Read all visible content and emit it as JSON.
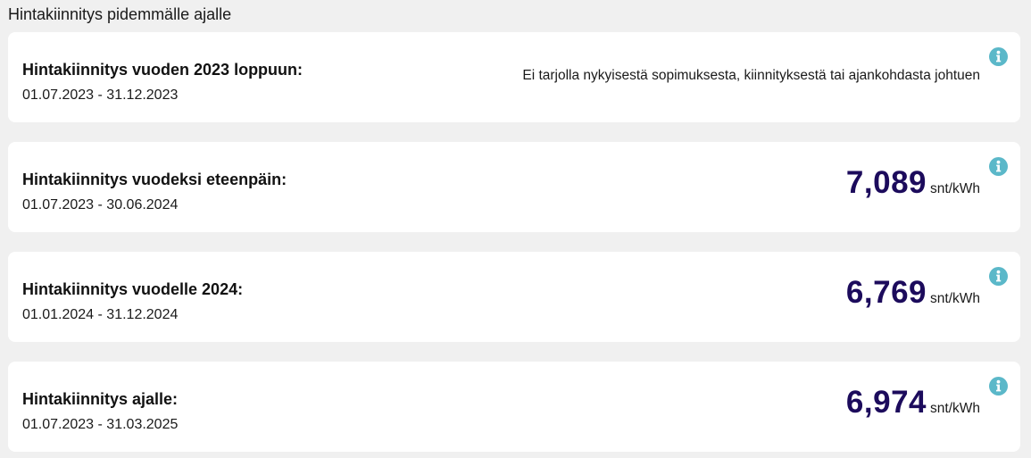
{
  "section": {
    "title": "Hintakiinnitys pidemmälle ajalle"
  },
  "cards": [
    {
      "title": "Hintakiinnitys vuoden 2023 loppuun:",
      "dates": "01.07.2023 - 31.12.2023",
      "note": "Ei tarjolla nykyisestä sopimuksesta, kiinnityksestä tai ajankohdasta johtuen",
      "icon": "info-icon"
    },
    {
      "title": "Hintakiinnitys vuodeksi eteenpäin:",
      "dates": "01.07.2023 - 30.06.2024",
      "price": "7,089",
      "unit": "snt/kWh",
      "icon": "info-icon"
    },
    {
      "title": "Hintakiinnitys vuodelle 2024:",
      "dates": "01.01.2024 - 31.12.2024",
      "price": "6,769",
      "unit": "snt/kWh",
      "icon": "info-icon"
    },
    {
      "title": "Hintakiinnitys ajalle:",
      "dates": "01.07.2023 - 31.03.2025",
      "price": "6,974",
      "unit": "snt/kWh",
      "icon": "info-icon"
    }
  ],
  "colors": {
    "background": "#f0f0f0",
    "card": "#ffffff",
    "price": "#1c0b5c",
    "info_icon": "#5bb8c9"
  }
}
